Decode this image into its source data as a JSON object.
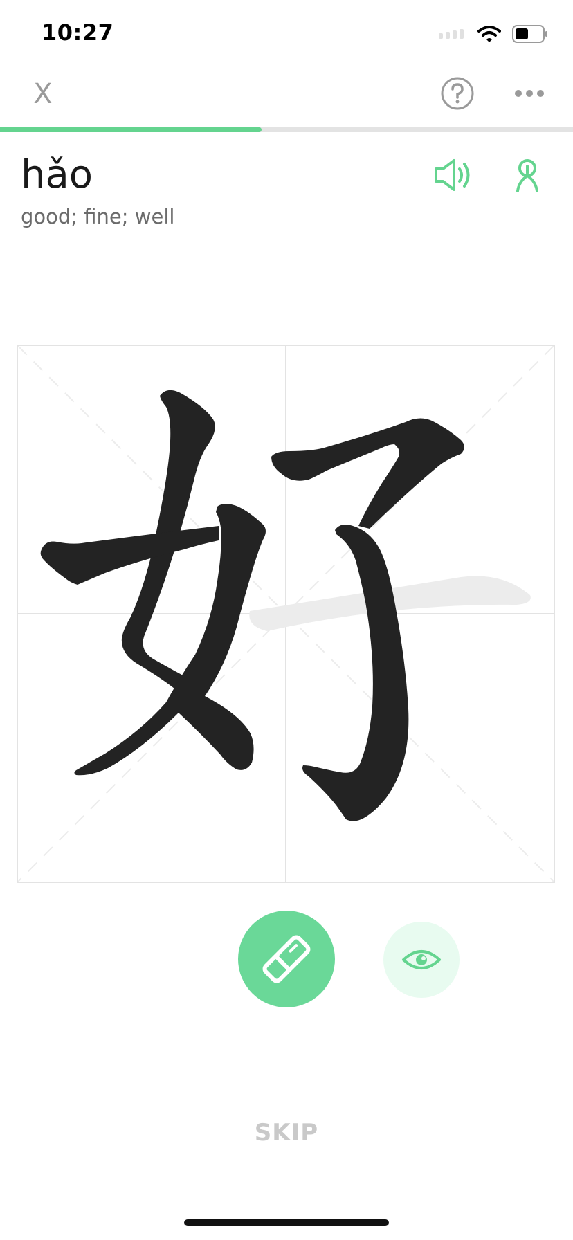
{
  "status_bar": {
    "time": "10:27",
    "icons": [
      "signal-icon",
      "wifi-icon",
      "battery-icon"
    ]
  },
  "header": {
    "close_label": "X",
    "help_icon": "question-circle-icon",
    "more_icon": "ellipsis-icon"
  },
  "progress": {
    "fraction": 0.457
  },
  "word": {
    "pinyin": "hǎo",
    "definition": "good; fine; well",
    "character": "好"
  },
  "actions": {
    "audio_icon": "speaker-icon",
    "stroke_icon": "stroke-practice-icon",
    "eraser_icon": "eraser-icon",
    "hint_icon": "eye-icon",
    "skip_label": "SKIP"
  },
  "colors": {
    "accent": "#64d48f",
    "accent_light": "#e8fbf0",
    "ink": "#222222",
    "grid": "#e3e3e3",
    "muted_text": "#6b6b6b",
    "skip_text": "#c9c9c9"
  }
}
